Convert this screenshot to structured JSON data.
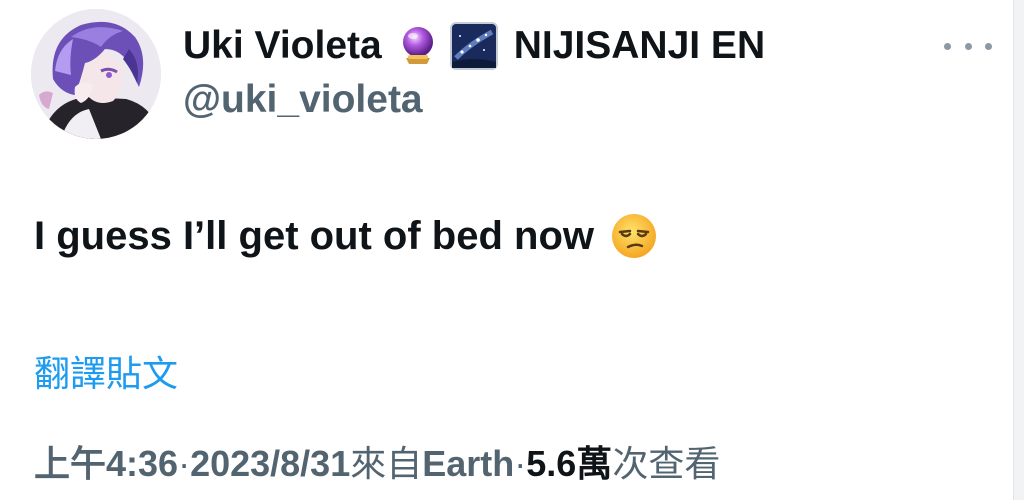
{
  "author": {
    "display_name": "Uki Violeta",
    "affiliation": "NIJISANJI EN",
    "handle": "@uki_violeta",
    "emoji_1": "crystal-ball-icon",
    "emoji_2": "milky-way-icon"
  },
  "tweet": {
    "text": "I guess I’ll get out of bed now",
    "emoji": "unamused-face-icon"
  },
  "translate_label": "翻譯貼文",
  "meta": {
    "time": "上午4:36",
    "sep1": " · ",
    "date": "2023/8/31",
    "source_prefix": " 來自 ",
    "source": "Earth",
    "sep2": " · ",
    "views": "5.6萬",
    "views_label": " 次查看"
  },
  "colors": {
    "text_primary": "#0f1419",
    "text_secondary": "#536471",
    "link": "#1d9bf0"
  }
}
